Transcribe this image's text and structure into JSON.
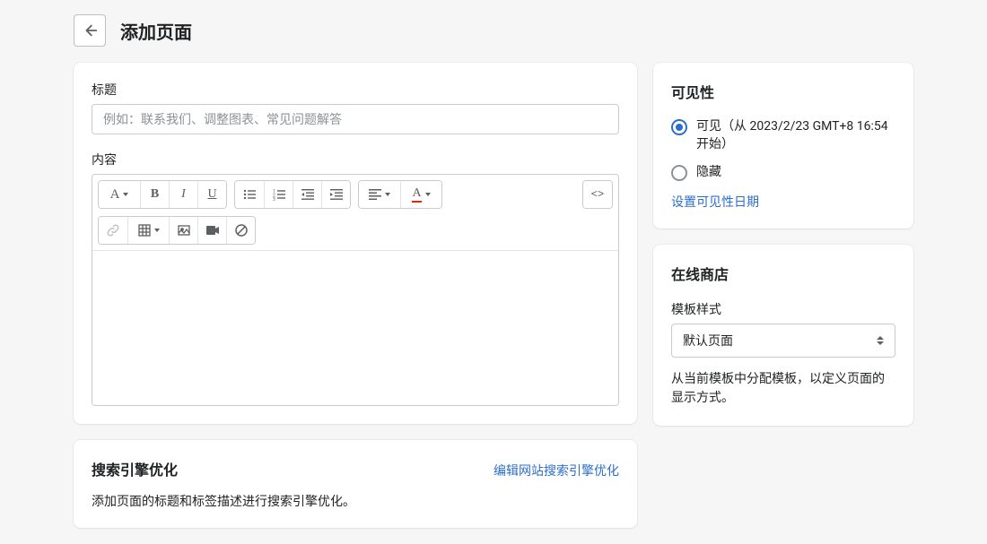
{
  "header": {
    "title": "添加页面"
  },
  "main": {
    "title_label": "标题",
    "title_placeholder": "例如：联系我们、调整图表、常见问题解答",
    "content_label": "内容"
  },
  "seo": {
    "title": "搜索引擎优化",
    "edit_link": "编辑网站搜索引擎优化",
    "description": "添加页面的标题和标签描述进行搜索引擎优化。"
  },
  "visibility": {
    "title": "可见性",
    "visible_label": "可见（从 2023/2/23 GMT+8 16:54 开始）",
    "hidden_label": "隐藏",
    "set_date_link": "设置可见性日期"
  },
  "online_store": {
    "title": "在线商店",
    "template_label": "模板样式",
    "template_selected": "默认页面",
    "help_text": "从当前模板中分配模板，以定义页面的显示方式。"
  }
}
